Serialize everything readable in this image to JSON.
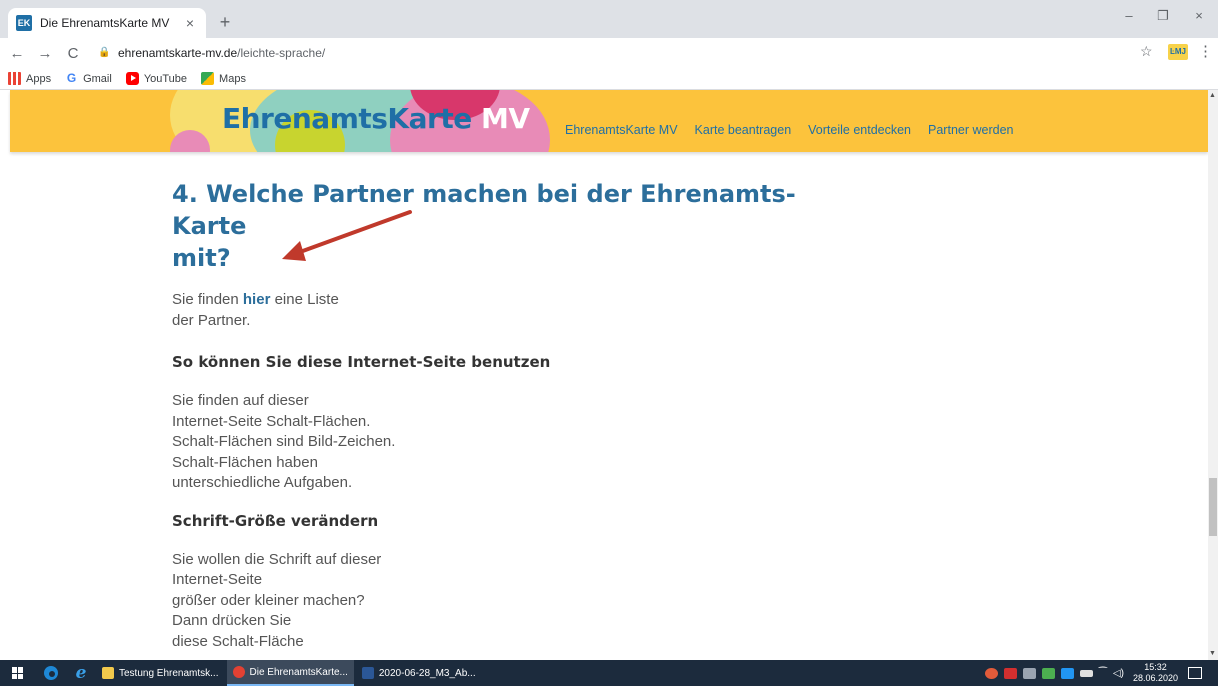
{
  "browser": {
    "tab": {
      "favicon_text": "EK",
      "title": "Die EhrenamtsKarte MV",
      "close": "×"
    },
    "new_tab": "+",
    "window": {
      "minimize": "–",
      "maximize": "❐",
      "close": "×"
    },
    "nav": {
      "back": "←",
      "forward": "→",
      "reload": "C"
    },
    "url": {
      "host": "ehrenamtskarte-mv.de",
      "path": "/leichte-sprache/"
    },
    "star": "☆",
    "extension_text": "ĿMJ",
    "menu": "⋮",
    "bookmarks": [
      {
        "label": "Apps",
        "icon": "apps-icon"
      },
      {
        "label": "Gmail",
        "icon": "google-icon"
      },
      {
        "label": "YouTube",
        "icon": "youtube-icon"
      },
      {
        "label": "Maps",
        "icon": "maps-icon"
      }
    ]
  },
  "site": {
    "logo": {
      "part1": "EhrenamtsKarte",
      "part2": "MV"
    },
    "nav": [
      "EhrenamtsKarte MV",
      "Karte beantragen",
      "Vorteile entdecken",
      "Partner werden"
    ],
    "colors": {
      "header": "#fcc33c",
      "brand_blue": "#1f6fa6",
      "heading_blue": "#2c6e9b"
    }
  },
  "content": {
    "heading_lines": [
      "4. Welche Partner machen bei der Ehrenamts-Karte",
      "mit?"
    ],
    "intro": {
      "before": "Sie finden ",
      "link": "hier",
      "after": " eine Liste",
      "line2": "der Partner."
    },
    "section1": {
      "title": "So können Sie diese Internet-Seite benutzen",
      "lines": [
        "Sie finden auf dieser",
        "Internet-Seite Schalt-Flächen.",
        "Schalt-Flächen sind Bild-Zeichen.",
        "Schalt-Flächen haben",
        "unterschiedliche Aufgaben."
      ]
    },
    "section2": {
      "title": "Schrift-Größe verändern",
      "lines": [
        "Sie wollen die Schrift auf dieser",
        "Internet-Seite",
        "größer oder kleiner machen?",
        "Dann drücken Sie",
        "diese Schalt-Fläche"
      ]
    }
  },
  "taskbar": {
    "apps": [
      {
        "label": "Testung Ehrenamtsk...",
        "color": "#f2c94c",
        "active": false
      },
      {
        "label": "Die EhrenamtsKarte...",
        "color": "#e34133",
        "active": true
      },
      {
        "label": "2020-06-28_M3_Ab...",
        "color": "#2b5797",
        "active": false
      }
    ],
    "time": "15:32",
    "date": "28.06.2020"
  }
}
